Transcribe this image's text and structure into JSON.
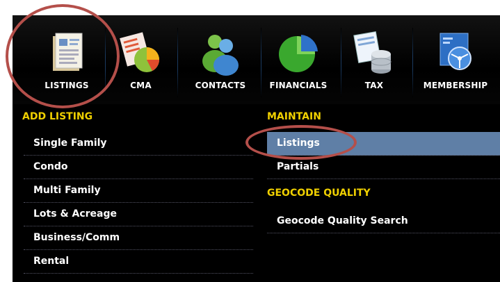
{
  "toolbar": {
    "items": [
      {
        "label": "LISTINGS"
      },
      {
        "label": "CMA"
      },
      {
        "label": "CONTACTS"
      },
      {
        "label": "FINANCIALS"
      },
      {
        "label": "TAX"
      },
      {
        "label": "MEMBERSHIP"
      }
    ]
  },
  "menu": {
    "add_listing": {
      "heading": "ADD LISTING",
      "items": [
        "Single Family",
        "Condo",
        "Multi Family",
        "Lots & Acreage",
        "Business/Comm",
        "Rental"
      ]
    },
    "maintain": {
      "heading": "MAINTAIN",
      "items": [
        "Listings",
        "Partials"
      ],
      "selected": "Listings"
    },
    "geocode_quality": {
      "heading": "GEOCODE QUALITY",
      "items": [
        "Geocode Quality Search"
      ]
    }
  },
  "colors": {
    "heading": "#f0d000",
    "selected_row": "#5f7fa6",
    "highlight_ring": "#b44f4a",
    "background": "#000000"
  }
}
